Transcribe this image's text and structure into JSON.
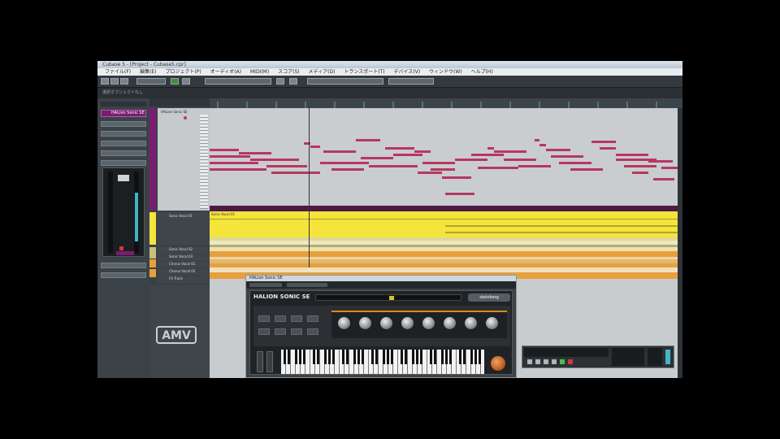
{
  "window": {
    "title": "Cubase 5 - [Project - Cubase5.cpr]"
  },
  "menu": [
    "ファイル(F)",
    "編集(E)",
    "プロジェクト(P)",
    "オーディオ(A)",
    "MIDI(M)",
    "スコア(S)",
    "メディア(D)",
    "トランスポート(T)",
    "デバイス(V)",
    "ウィンドウ(W)",
    "ヘルプ(H)"
  ],
  "infoline": "選択オブジェクトなし",
  "inspector": {
    "track_name": "HALion Sonic SE"
  },
  "tracks": [
    {
      "label": "HALion Sonic SE"
    },
    {
      "label": "Sonic Vocal 01"
    },
    {
      "label": "Sonic Vocal 02"
    },
    {
      "label": "Sonic Vocal 03"
    },
    {
      "label": "Chorus Vocal 01"
    },
    {
      "label": "Chorus Vocal 02"
    },
    {
      "label": "FX Track"
    }
  ],
  "audio_event_label": "Sonic Vocal 01",
  "plugin": {
    "title": "HALion Sonic SE",
    "product": "HALION SONIC SE",
    "brand": "steinberg"
  },
  "logo": "AMV",
  "colors": {
    "purple_track": "#7a1d72",
    "midi_notes": "#b8375f",
    "audio_yellow": "#f4e43c",
    "orange_track": "#e6a03c"
  }
}
